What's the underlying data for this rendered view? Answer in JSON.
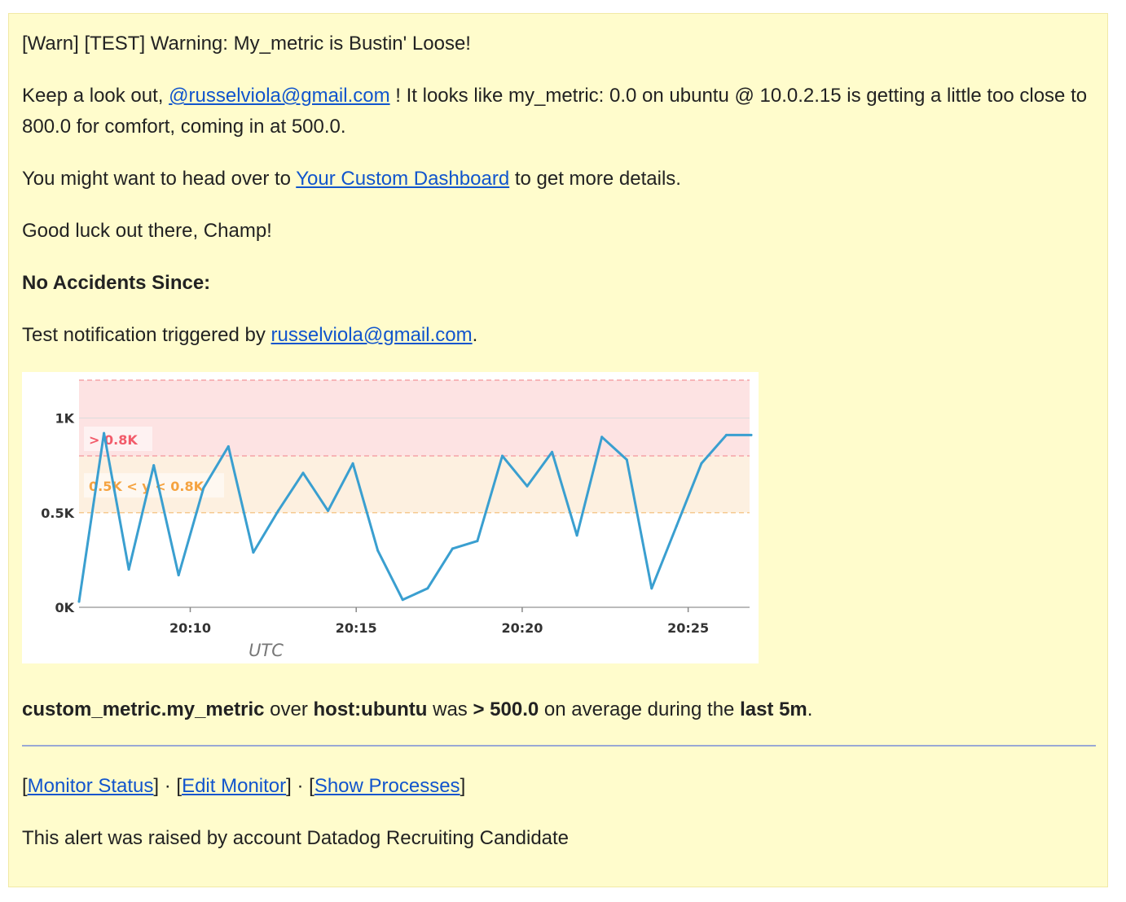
{
  "email": {
    "subject_line": "[Warn] [TEST] Warning: My_metric is Bustin' Loose!",
    "keep_look": {
      "prefix": "Keep a look out, ",
      "mention": "@russelviola@gmail.com",
      "suffix": " ! It looks like my_metric: 0.0 on ubuntu @ 10.0.2.15 is getting a little too close to 800.0 for comfort, coming in at 500.0."
    },
    "dashboard": {
      "prefix": "You might want to head over to ",
      "link": "Your Custom Dashboard",
      "suffix": " to get more details."
    },
    "good_luck": "Good luck out there, Champ!",
    "no_accidents": "No Accidents Since:",
    "triggered": {
      "prefix": "Test notification triggered by ",
      "link": "russelviola@gmail.com",
      "suffix": "."
    },
    "summary": {
      "metric": "custom_metric.my_metric",
      "over": " over ",
      "host": "host:ubuntu",
      "was": " was ",
      "threshold": "> 500.0",
      "during": " on average during the ",
      "window": "last 5m",
      "end": "."
    },
    "footer_links": {
      "monitor_status": "Monitor Status",
      "edit_monitor": "Edit Monitor",
      "show_processes": "Show Processes",
      "separator": "] · ["
    },
    "raised_by": "This alert was raised by account Datadog Recruiting Candidate"
  },
  "colors": {
    "background": "#fffccc",
    "link": "#1155cc",
    "series": "#3a9fd0",
    "alert_band": "#fde3e3",
    "warn_band": "#fdf0e0",
    "alert_text": "#f25b6a",
    "warn_text": "#f5a340"
  },
  "chart_data": {
    "type": "line",
    "xlabel": "UTC",
    "ylabel": "",
    "x_tick_labels": [
      "20:10",
      "20:15",
      "20:20",
      "20:25"
    ],
    "y_tick_labels": [
      "0K",
      "0.5K",
      "1K"
    ],
    "y_ticks": [
      0,
      500,
      1000
    ],
    "ylim": [
      0,
      1200
    ],
    "xlim_minutes_after_20_06": [
      0.4,
      20.6
    ],
    "x_ticks_minutes": [
      3.75,
      8.75,
      13.75,
      18.75
    ],
    "thresholds": {
      "alert": {
        "label": "> 0.8K",
        "min": 800
      },
      "warning": {
        "label": "0.5K < y < 0.8K",
        "min": 500,
        "max": 800
      }
    },
    "series": [
      {
        "x_minutes": [
          0.4,
          1.15,
          1.9,
          2.65,
          3.4,
          4.15,
          4.9,
          5.65,
          6.4,
          7.15,
          7.9,
          8.65,
          9.4,
          10.15,
          10.9,
          11.65,
          12.4,
          13.15,
          13.9,
          14.65,
          15.4,
          16.15,
          16.9,
          17.65,
          18.4,
          19.15,
          19.9,
          20.65
        ],
        "values": [
          30,
          920,
          200,
          750,
          170,
          630,
          850,
          290,
          510,
          710,
          510,
          760,
          300,
          40,
          100,
          310,
          350,
          800,
          640,
          820,
          380,
          900,
          780,
          100,
          430,
          760,
          910,
          910
        ]
      }
    ]
  }
}
